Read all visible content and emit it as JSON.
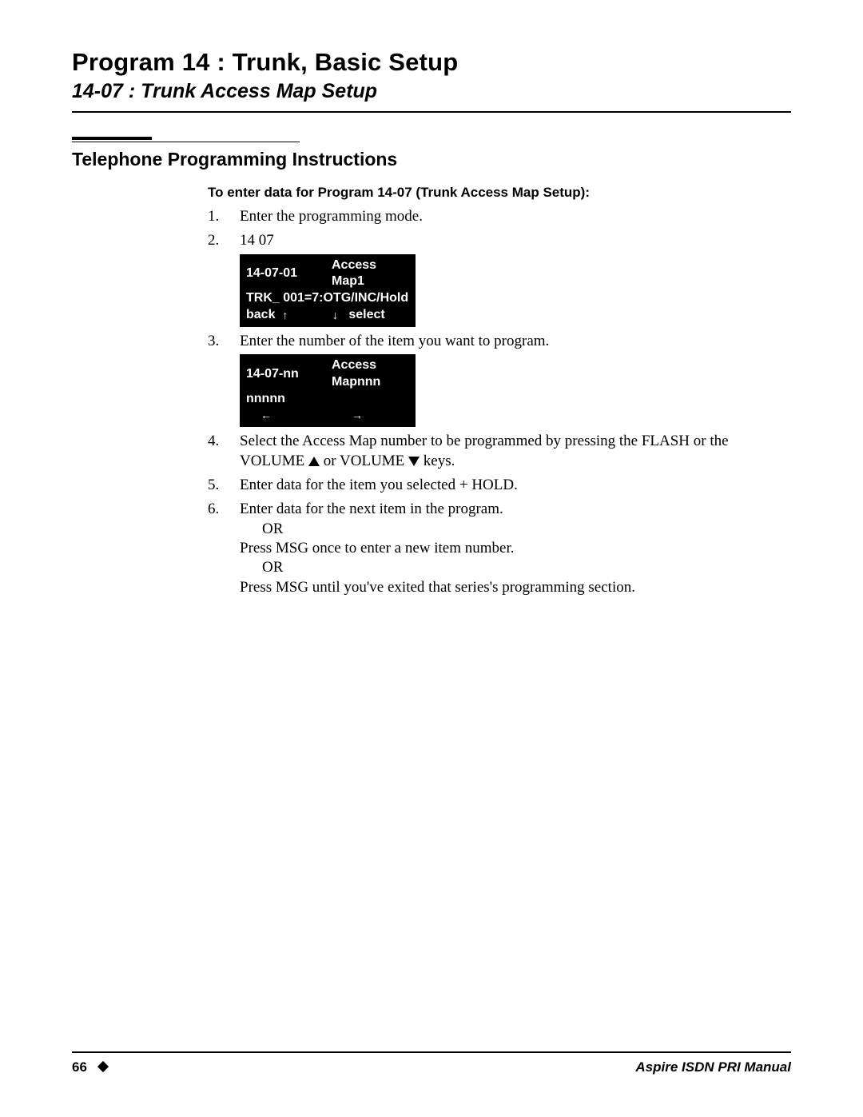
{
  "header": {
    "program_title": "Program 14 : Trunk, Basic Setup",
    "section_code": "14-07 : Trunk Access Map Setup"
  },
  "section": {
    "title": "Telephone Programming Instructions",
    "entry_header": "To enter data for Program 14-07 (Trunk Access Map Setup):"
  },
  "steps": {
    "s1": {
      "num": "1.",
      "text": "Enter the programming mode."
    },
    "s2": {
      "num": "2.",
      "text": "14 07",
      "lcd": {
        "line1_left": "14-07-01",
        "line1_right": "Access Map1",
        "line2": "TRK_ 001=7:OTG/INC/Hold",
        "line3_left": "back",
        "line3_mid_up": "↑",
        "line3_mid_down": "↓",
        "line3_right": "select"
      }
    },
    "s3": {
      "num": "3.",
      "text": "Enter the number of the item you want to program.",
      "lcd": {
        "line1_left": "14-07-nn",
        "line1_right": "Access Mapnnn",
        "line2": "nnnnn",
        "line3_left_arrow": "←",
        "line3_right_arrow": "→"
      }
    },
    "s4": {
      "num": "4.",
      "text_a": "Select the Access Map number to be programmed by pressing the FLASH or the VOLUME ",
      "text_b": " or VOLUME ",
      "text_c": " keys."
    },
    "s5": {
      "num": "5.",
      "text": "Enter data for the item you selected + HOLD."
    },
    "s6": {
      "num": "6.",
      "text": "Enter data for the next item in the program.",
      "or1": "OR",
      "alt1": "Press MSG once to enter a new item number.",
      "or2": "OR",
      "alt2": "Press MSG until you've exited that series's programming section."
    }
  },
  "footer": {
    "page_number": "66",
    "manual_name": "Aspire ISDN PRI Manual"
  }
}
